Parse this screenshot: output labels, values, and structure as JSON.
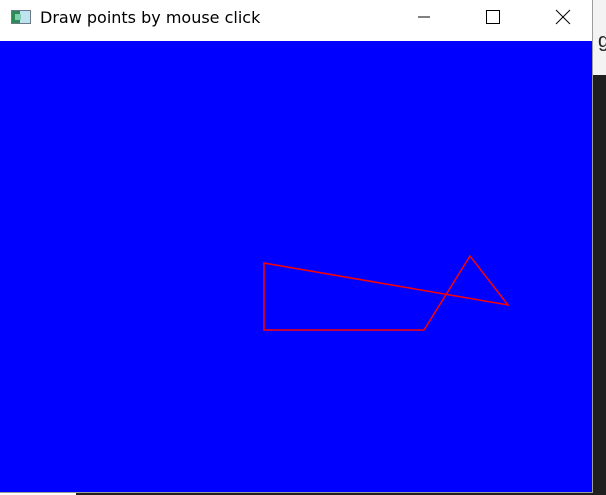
{
  "window": {
    "title": "Draw points by mouse click",
    "icon": "app-window-icon"
  },
  "titlebar_buttons": {
    "minimize": "minimize-icon",
    "maximize": "maximize-icon",
    "close": "close-icon"
  },
  "canvas": {
    "background_color": "#0000ff",
    "stroke_color": "#ff0000"
  },
  "background_app": {
    "partial_text": "g"
  }
}
